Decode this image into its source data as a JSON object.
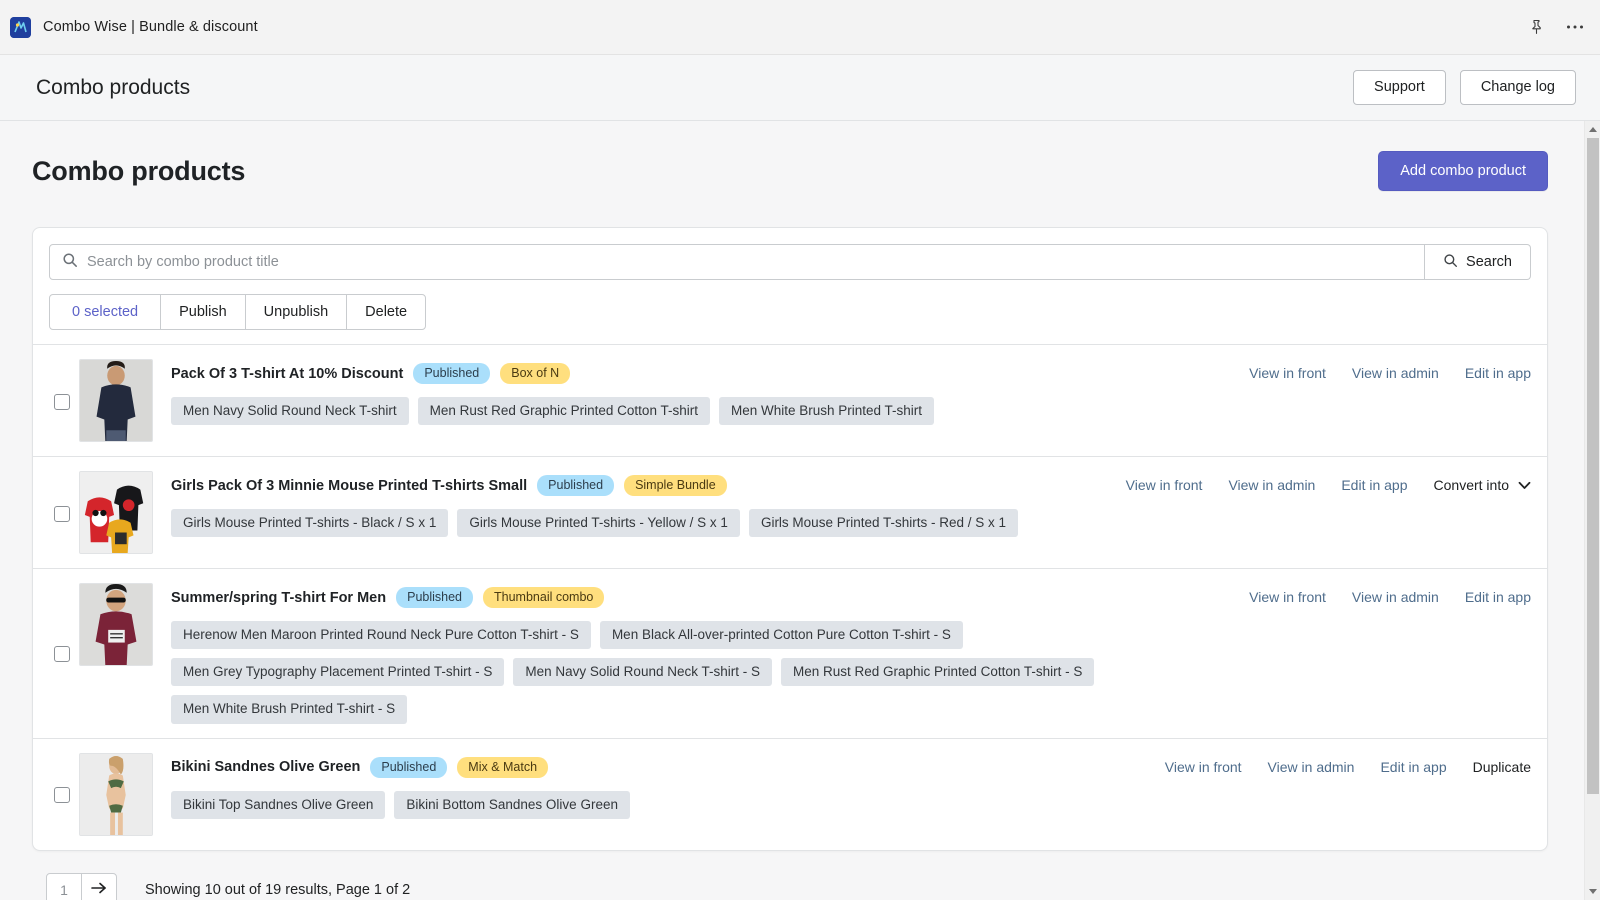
{
  "titlebar": {
    "app_icon": "combo-wise-app-icon",
    "title": "Combo Wise | Bundle & discount",
    "pin_icon": "pin-icon",
    "more_icon": "ellipsis-icon"
  },
  "header": {
    "title": "Combo products",
    "support_label": "Support",
    "changelog_label": "Change log"
  },
  "page": {
    "title": "Combo products",
    "add_button": "Add combo product",
    "accent_color": "#5c62c8"
  },
  "search": {
    "placeholder": "Search by combo product title",
    "value": "",
    "search_icon": "search-icon",
    "button_label": "Search"
  },
  "bulk_actions": {
    "selected_label": "0 selected",
    "publish_label": "Publish",
    "unpublish_label": "Unpublish",
    "delete_label": "Delete"
  },
  "rows": [
    {
      "title": "Pack Of 3 T-shirt At 10% Discount",
      "status": "Published",
      "type": "Box of N",
      "thumb": "man-navy-tshirt-photo",
      "tags": [
        "Men Navy Solid Round Neck T-shirt",
        "Men Rust Red Graphic Printed Cotton T-shirt",
        "Men White Brush Printed T-shirt"
      ],
      "actions": [
        {
          "label": "View in front",
          "style": "link"
        },
        {
          "label": "View in admin",
          "style": "link"
        },
        {
          "label": "Edit in app",
          "style": "link"
        }
      ]
    },
    {
      "title": "Girls Pack Of 3 Minnie Mouse Printed T-shirts Small",
      "status": "Published",
      "type": "Simple Bundle",
      "thumb": "girls-minnie-tshirts-photo",
      "tags": [
        "Girls Mouse Printed T-shirts - Black / S  x 1",
        "Girls Mouse Printed T-shirts - Yellow / S  x 1",
        "Girls Mouse Printed T-shirts - Red / S  x 1"
      ],
      "actions": [
        {
          "label": "View in front",
          "style": "link"
        },
        {
          "label": "View in admin",
          "style": "link"
        },
        {
          "label": "Edit in app",
          "style": "link"
        },
        {
          "label": "Convert into",
          "style": "dropdown"
        }
      ]
    },
    {
      "title": "Summer/spring T-shirt For Men",
      "status": "Published",
      "type": "Thumbnail combo",
      "thumb": "man-maroon-tshirt-photo",
      "tags": [
        "Herenow Men Maroon Printed Round Neck Pure Cotton T-shirt - S",
        "Men Black All-over-printed Cotton Pure Cotton T-shirt - S",
        "Men Grey Typography Placement Printed T-shirt - S",
        "Men Navy Solid Round Neck T-shirt - S",
        "Men Rust Red Graphic Printed Cotton T-shirt - S",
        "Men White Brush Printed T-shirt - S"
      ],
      "actions": [
        {
          "label": "View in front",
          "style": "link"
        },
        {
          "label": "View in admin",
          "style": "link"
        },
        {
          "label": "Edit in app",
          "style": "link"
        }
      ]
    },
    {
      "title": "Bikini Sandnes Olive Green",
      "status": "Published",
      "type": "Mix & Match",
      "thumb": "woman-olive-bikini-photo",
      "tags": [
        "Bikini Top Sandnes Olive Green",
        "Bikini Bottom Sandnes Olive Green"
      ],
      "actions": [
        {
          "label": "View in front",
          "style": "link"
        },
        {
          "label": "View in admin",
          "style": "link"
        },
        {
          "label": "Edit in app",
          "style": "link"
        },
        {
          "label": "Duplicate",
          "style": "plain"
        }
      ]
    }
  ],
  "pagination": {
    "page_number": "1",
    "next_icon": "arrow-right-icon",
    "summary": "Showing 10 out of 19 results, Page 1 of 2"
  }
}
